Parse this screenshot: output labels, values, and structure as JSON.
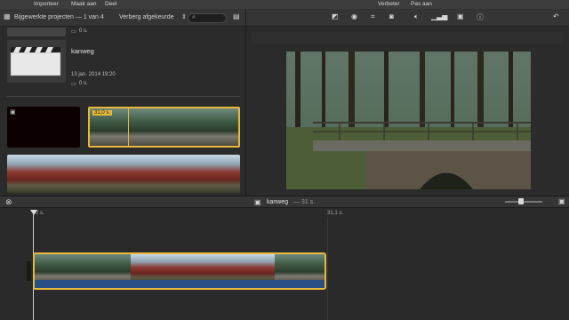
{
  "menu": {
    "import": "Importeer",
    "create": "Maak aan",
    "share": "Deel",
    "enhance": "Verbeter",
    "adjust": "Pas aan"
  },
  "library": {
    "title": "Bijgewerkte projecten — 1 van 4",
    "filter": "Verberg afgekeurde",
    "search_placeholder": "",
    "top_duration": "0 s.",
    "project": {
      "name": "kanweg",
      "date": "13 jan. 2014 19:20",
      "duration": "0 s."
    },
    "clip_badge": "31,0 s."
  },
  "timeline": {
    "title": "kanweg",
    "duration": "— 31 s.",
    "ruler_start": "0 s.",
    "ruler_end": "31,1 s."
  },
  "icons": {
    "back": "back-arrow-icon"
  }
}
